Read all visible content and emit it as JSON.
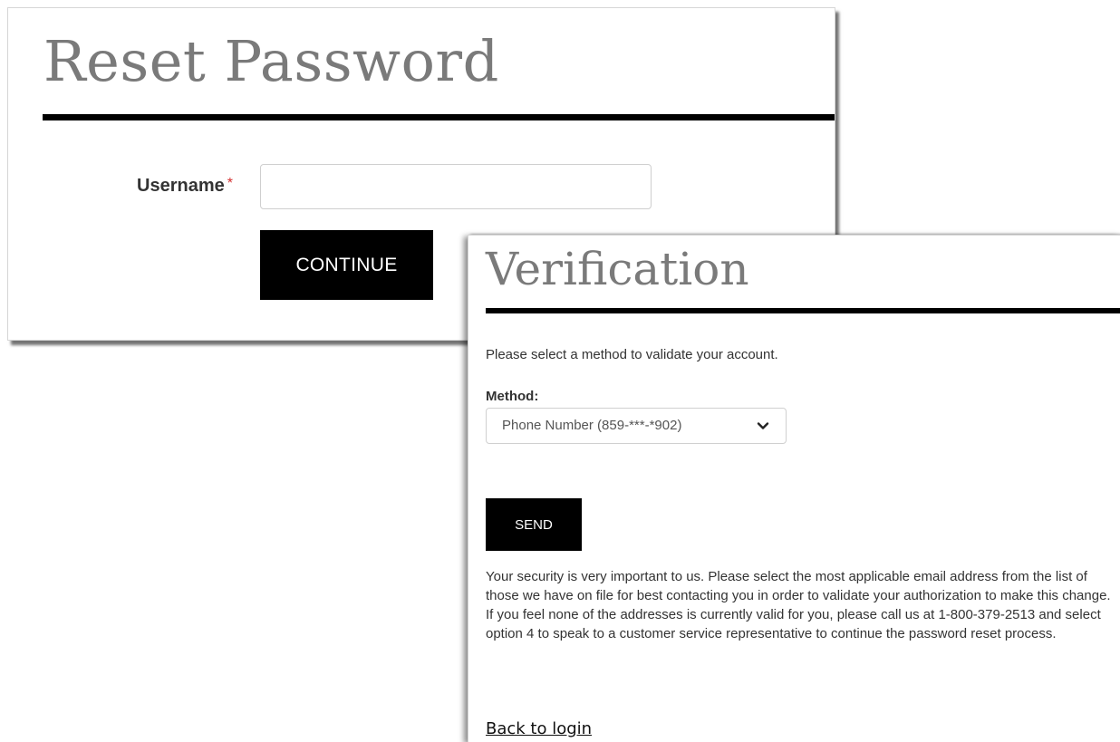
{
  "reset": {
    "title": "Reset Password",
    "username_label": "Username",
    "required_marker": "*",
    "username_value": "",
    "continue_label": "CONTINUE"
  },
  "verification": {
    "title": "Verification",
    "prompt": "Please select a method to validate your account.",
    "method_label": "Method:",
    "method_selected": "Phone Number (859-***-*902)",
    "send_label": "SEND",
    "security_message": "Your security is very important to us. Please select the most applicable email address from the list of those we have on file for best contacting you in order to validate your authorization to make this change. If you feel none of the addresses is currently valid for you, please call us at 1-800-379-2513 and select option 4 to speak to a customer service representative to continue the password reset process.",
    "back_link": "Back to login"
  },
  "icons": {
    "dropdown": "chevron-down-icon"
  },
  "colors": {
    "button_bg": "#000000",
    "title_gray": "#7a7a7a",
    "required_red": "#d32f2f"
  }
}
